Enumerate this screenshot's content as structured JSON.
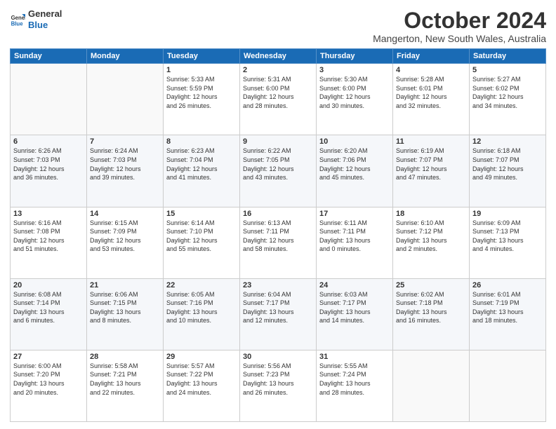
{
  "header": {
    "logo_line1": "General",
    "logo_line2": "Blue",
    "title": "October 2024",
    "subtitle": "Mangerton, New South Wales, Australia"
  },
  "weekdays": [
    "Sunday",
    "Monday",
    "Tuesday",
    "Wednesday",
    "Thursday",
    "Friday",
    "Saturday"
  ],
  "weeks": [
    [
      {
        "day": "",
        "text": ""
      },
      {
        "day": "",
        "text": ""
      },
      {
        "day": "1",
        "text": "Sunrise: 5:33 AM\nSunset: 5:59 PM\nDaylight: 12 hours\nand 26 minutes."
      },
      {
        "day": "2",
        "text": "Sunrise: 5:31 AM\nSunset: 6:00 PM\nDaylight: 12 hours\nand 28 minutes."
      },
      {
        "day": "3",
        "text": "Sunrise: 5:30 AM\nSunset: 6:00 PM\nDaylight: 12 hours\nand 30 minutes."
      },
      {
        "day": "4",
        "text": "Sunrise: 5:28 AM\nSunset: 6:01 PM\nDaylight: 12 hours\nand 32 minutes."
      },
      {
        "day": "5",
        "text": "Sunrise: 5:27 AM\nSunset: 6:02 PM\nDaylight: 12 hours\nand 34 minutes."
      }
    ],
    [
      {
        "day": "6",
        "text": "Sunrise: 6:26 AM\nSunset: 7:03 PM\nDaylight: 12 hours\nand 36 minutes."
      },
      {
        "day": "7",
        "text": "Sunrise: 6:24 AM\nSunset: 7:03 PM\nDaylight: 12 hours\nand 39 minutes."
      },
      {
        "day": "8",
        "text": "Sunrise: 6:23 AM\nSunset: 7:04 PM\nDaylight: 12 hours\nand 41 minutes."
      },
      {
        "day": "9",
        "text": "Sunrise: 6:22 AM\nSunset: 7:05 PM\nDaylight: 12 hours\nand 43 minutes."
      },
      {
        "day": "10",
        "text": "Sunrise: 6:20 AM\nSunset: 7:06 PM\nDaylight: 12 hours\nand 45 minutes."
      },
      {
        "day": "11",
        "text": "Sunrise: 6:19 AM\nSunset: 7:07 PM\nDaylight: 12 hours\nand 47 minutes."
      },
      {
        "day": "12",
        "text": "Sunrise: 6:18 AM\nSunset: 7:07 PM\nDaylight: 12 hours\nand 49 minutes."
      }
    ],
    [
      {
        "day": "13",
        "text": "Sunrise: 6:16 AM\nSunset: 7:08 PM\nDaylight: 12 hours\nand 51 minutes."
      },
      {
        "day": "14",
        "text": "Sunrise: 6:15 AM\nSunset: 7:09 PM\nDaylight: 12 hours\nand 53 minutes."
      },
      {
        "day": "15",
        "text": "Sunrise: 6:14 AM\nSunset: 7:10 PM\nDaylight: 12 hours\nand 55 minutes."
      },
      {
        "day": "16",
        "text": "Sunrise: 6:13 AM\nSunset: 7:11 PM\nDaylight: 12 hours\nand 58 minutes."
      },
      {
        "day": "17",
        "text": "Sunrise: 6:11 AM\nSunset: 7:11 PM\nDaylight: 13 hours\nand 0 minutes."
      },
      {
        "day": "18",
        "text": "Sunrise: 6:10 AM\nSunset: 7:12 PM\nDaylight: 13 hours\nand 2 minutes."
      },
      {
        "day": "19",
        "text": "Sunrise: 6:09 AM\nSunset: 7:13 PM\nDaylight: 13 hours\nand 4 minutes."
      }
    ],
    [
      {
        "day": "20",
        "text": "Sunrise: 6:08 AM\nSunset: 7:14 PM\nDaylight: 13 hours\nand 6 minutes."
      },
      {
        "day": "21",
        "text": "Sunrise: 6:06 AM\nSunset: 7:15 PM\nDaylight: 13 hours\nand 8 minutes."
      },
      {
        "day": "22",
        "text": "Sunrise: 6:05 AM\nSunset: 7:16 PM\nDaylight: 13 hours\nand 10 minutes."
      },
      {
        "day": "23",
        "text": "Sunrise: 6:04 AM\nSunset: 7:17 PM\nDaylight: 13 hours\nand 12 minutes."
      },
      {
        "day": "24",
        "text": "Sunrise: 6:03 AM\nSunset: 7:17 PM\nDaylight: 13 hours\nand 14 minutes."
      },
      {
        "day": "25",
        "text": "Sunrise: 6:02 AM\nSunset: 7:18 PM\nDaylight: 13 hours\nand 16 minutes."
      },
      {
        "day": "26",
        "text": "Sunrise: 6:01 AM\nSunset: 7:19 PM\nDaylight: 13 hours\nand 18 minutes."
      }
    ],
    [
      {
        "day": "27",
        "text": "Sunrise: 6:00 AM\nSunset: 7:20 PM\nDaylight: 13 hours\nand 20 minutes."
      },
      {
        "day": "28",
        "text": "Sunrise: 5:58 AM\nSunset: 7:21 PM\nDaylight: 13 hours\nand 22 minutes."
      },
      {
        "day": "29",
        "text": "Sunrise: 5:57 AM\nSunset: 7:22 PM\nDaylight: 13 hours\nand 24 minutes."
      },
      {
        "day": "30",
        "text": "Sunrise: 5:56 AM\nSunset: 7:23 PM\nDaylight: 13 hours\nand 26 minutes."
      },
      {
        "day": "31",
        "text": "Sunrise: 5:55 AM\nSunset: 7:24 PM\nDaylight: 13 hours\nand 28 minutes."
      },
      {
        "day": "",
        "text": ""
      },
      {
        "day": "",
        "text": ""
      }
    ]
  ]
}
